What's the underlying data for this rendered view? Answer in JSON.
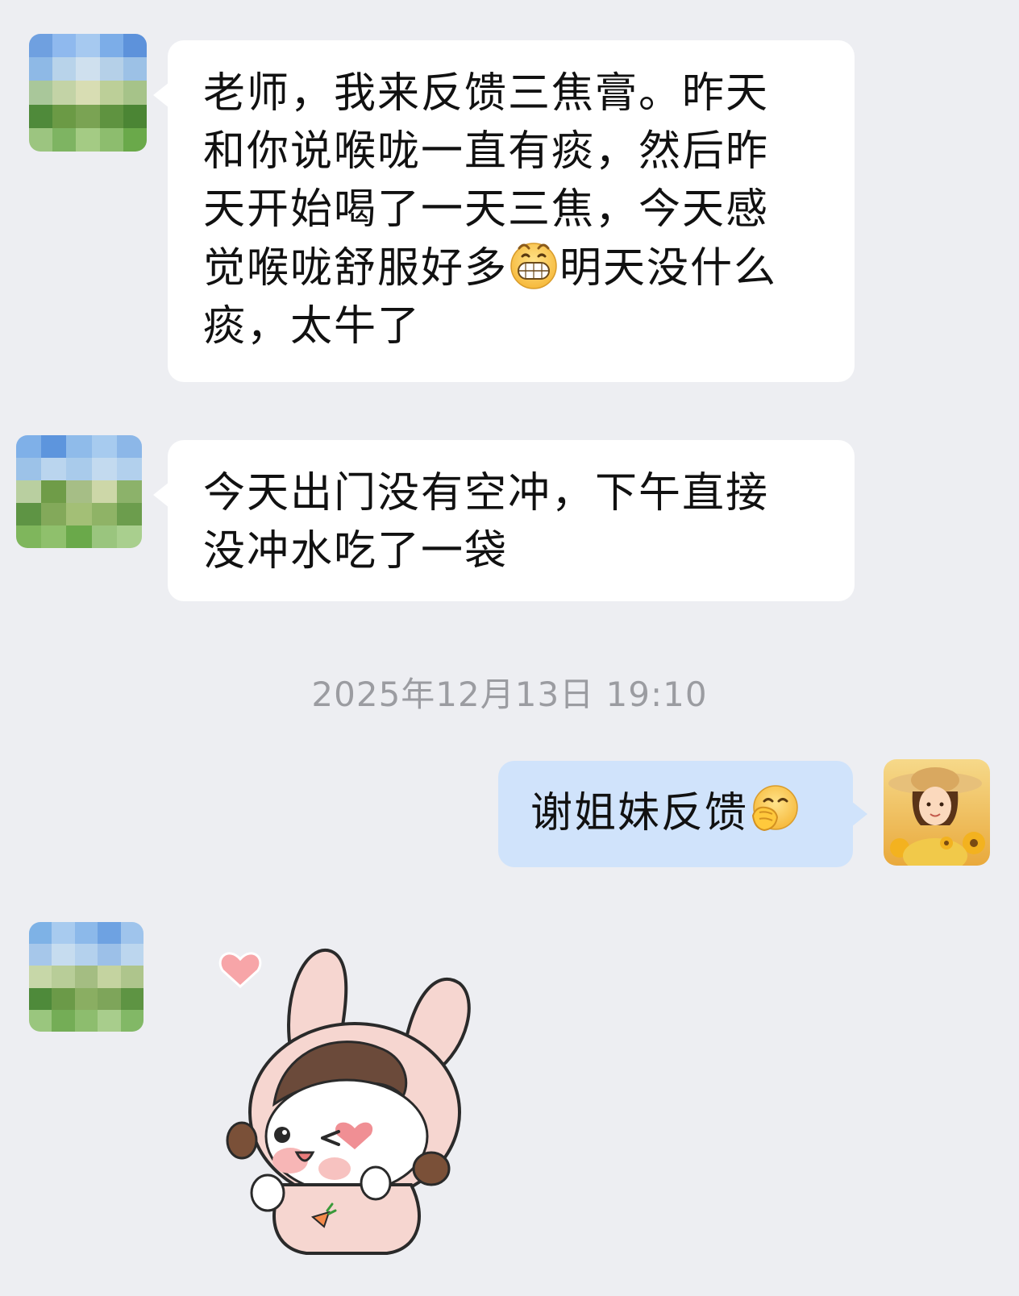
{
  "messages": [
    {
      "sender": "contact",
      "lines": [
        "老师，我来反馈三焦膏。昨天",
        "和你说喉咙一直有痰，然后昨",
        "天开始喝了一天三焦，今天感",
        "觉喉咙舒服好多",
        "明天没什么",
        "痰，太牛了"
      ],
      "emoji": "grinning-face-emoji"
    },
    {
      "sender": "contact",
      "lines": [
        "今天出门没有空冲，下午直接",
        "没冲水吃了一袋"
      ]
    },
    {
      "sender": "self",
      "text": "谢姐妹反馈",
      "emoji": "hand-over-mouth-emoji"
    },
    {
      "sender": "contact",
      "type": "sticker",
      "sticker": "bunny-hood-girl-wink-sticker"
    }
  ],
  "timestamp": "2025年12月13日  19:10",
  "colors": {
    "background": "#edeef2",
    "incoming_bubble": "#ffffff",
    "outgoing_bubble": "#d0e3fb",
    "timestamp_text": "#9b9ca1"
  }
}
